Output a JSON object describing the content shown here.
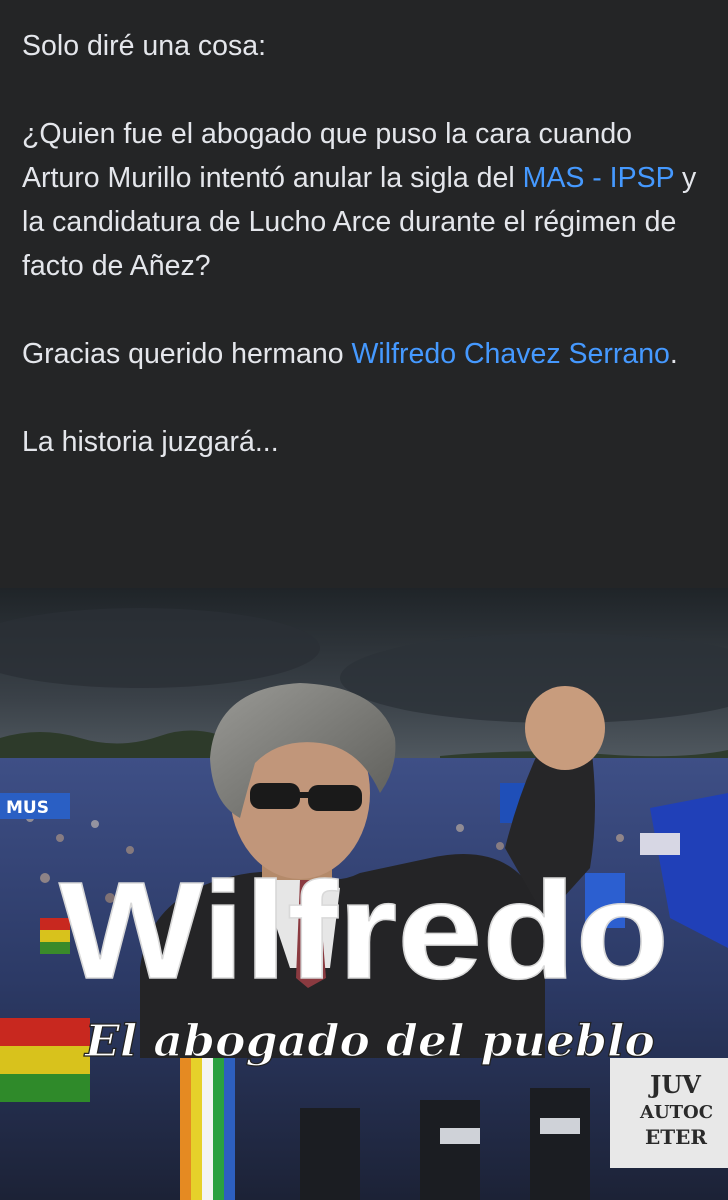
{
  "post": {
    "line1": "Solo diré una cosa:",
    "paragraph2": {
      "before": "¿Quien fue el abogado que puso la cara cuando Arturo Murillo intentó anular la sigla del ",
      "mention_party": "MAS - IPSP",
      "after": " y la candidatura de Lucho Arce durante el régimen de facto de Añez?"
    },
    "paragraph3": {
      "before": "Gracias querido hermano ",
      "mention_person": "Wilfredo Chavez Serrano",
      "after": "."
    },
    "closing": "La historia juzgará..."
  },
  "image": {
    "headline": "Wilfredo",
    "tagline": "El abogado del pueblo",
    "banner_left": "MUS",
    "banner_right_1": "JUV",
    "banner_right_2": "AUTOC",
    "banner_right_3": "ETER"
  },
  "colors": {
    "background": "#242526",
    "text": "#e4e6eb",
    "link": "#4599ff"
  }
}
